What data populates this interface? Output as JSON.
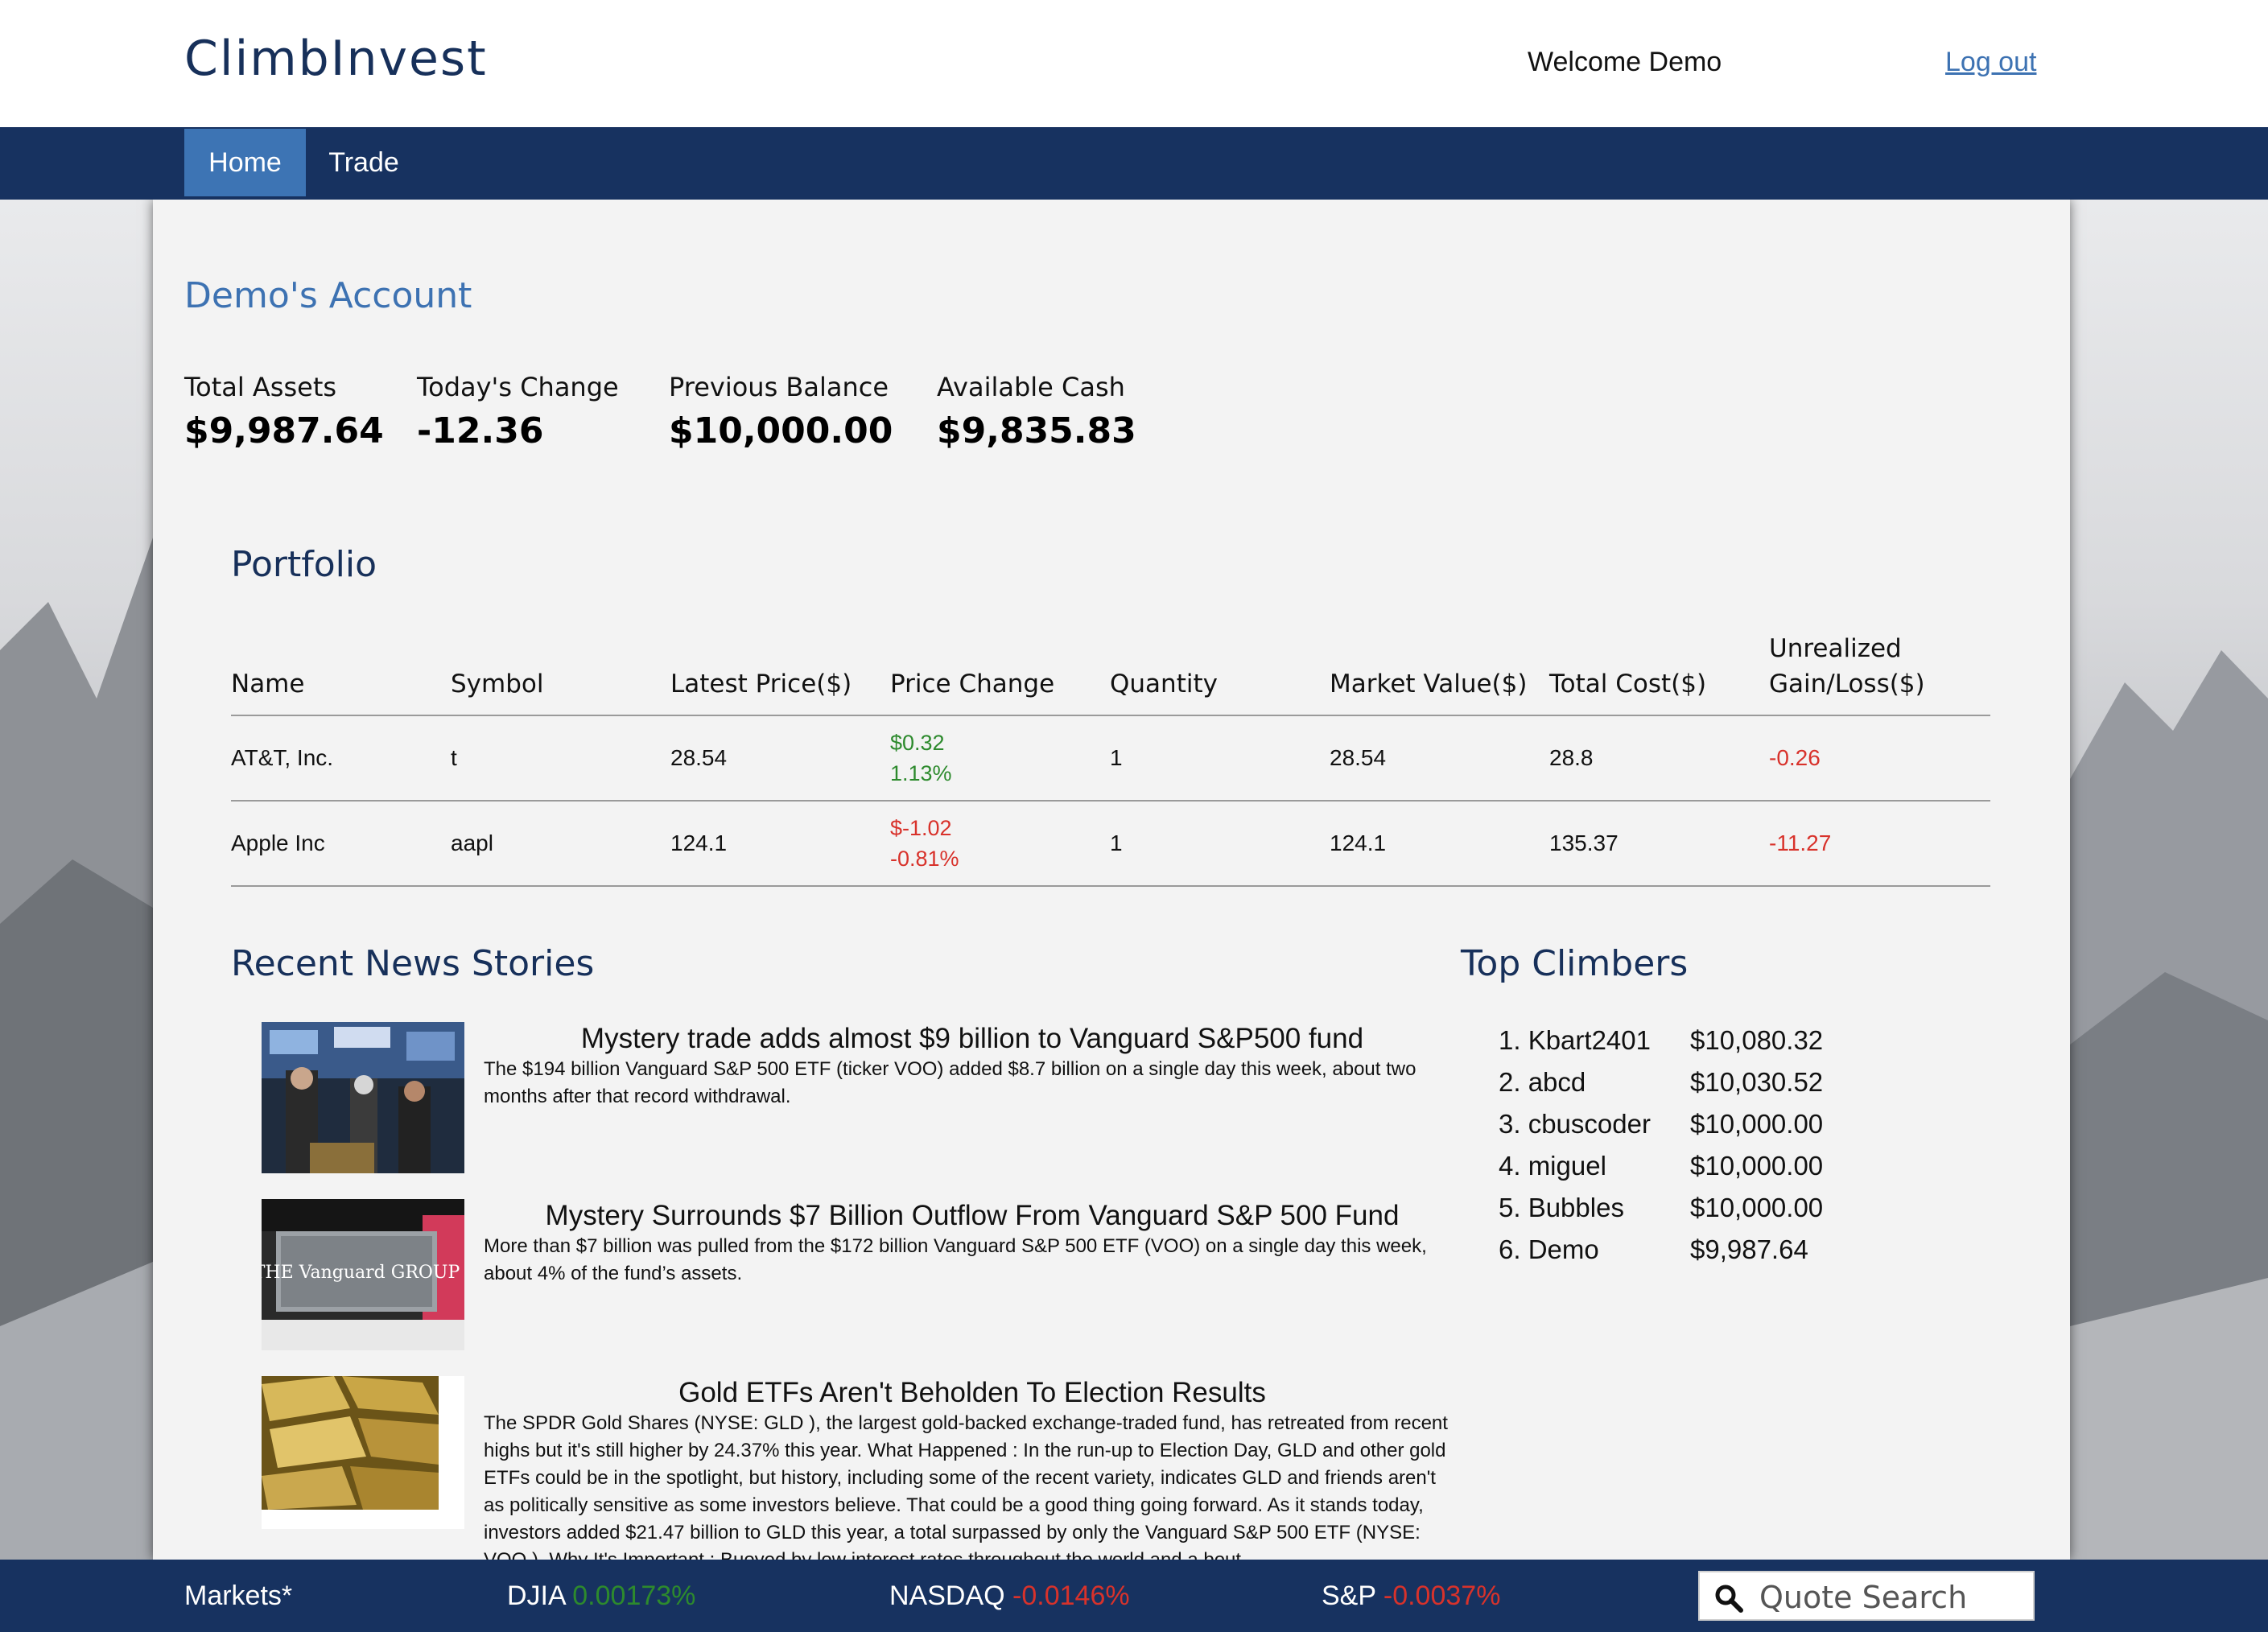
{
  "header": {
    "brand": "ClimbInvest",
    "welcome": "Welcome Demo",
    "logout": "Log out"
  },
  "nav": {
    "tabs": [
      {
        "label": "Home",
        "active": true
      },
      {
        "label": "Trade",
        "active": false
      }
    ]
  },
  "account": {
    "title": "Demo's Account",
    "stats": [
      {
        "label": "Total Assets",
        "value": "$9,987.64"
      },
      {
        "label": "Today's Change",
        "value": "-12.36"
      },
      {
        "label": "Previous Balance",
        "value": "$10,000.00"
      },
      {
        "label": "Available Cash",
        "value": "$9,835.83"
      }
    ]
  },
  "portfolio": {
    "title": "Portfolio",
    "columns": [
      "Name",
      "Symbol",
      "Latest Price($)",
      "Price Change",
      "Quantity",
      "Market Value($)",
      "Total Cost($)",
      "Unrealized",
      "Gain/Loss($)"
    ],
    "rows": [
      {
        "name": "AT&T, Inc.",
        "symbol": "t",
        "latest_price": "28.54",
        "change_amount": "$0.32",
        "change_percent": "1.13%",
        "quantity": "1",
        "market_value": "28.54",
        "total_cost": "28.8",
        "gain_loss": "-0.26"
      },
      {
        "name": "Apple Inc",
        "symbol": "aapl",
        "latest_price": "124.1",
        "change_amount": "$-1.02",
        "change_percent": "-0.81%",
        "quantity": "1",
        "market_value": "124.1",
        "total_cost": "135.37",
        "gain_loss": "-11.27"
      }
    ]
  },
  "news": {
    "title": "Recent News Stories",
    "items": [
      {
        "headline": "Mystery trade adds almost $9 billion to Vanguard S&P500 fund",
        "summary": "The $194 billion Vanguard S&P 500 ETF (ticker VOO) added $8.7 billion on a single day this week, about two months after that record withdrawal.",
        "image": "trading-floor-photo"
      },
      {
        "headline": "Mystery Surrounds $7 Billion Outflow From Vanguard S&P 500 Fund",
        "summary": "More than $7 billion was pulled from the $172 billion Vanguard S&P 500 ETF (VOO) on a single day this week, about 4% of the fund’s assets.",
        "image": "vanguard-sign-photo",
        "sign_text": "THE Vanguard GROUP"
      },
      {
        "headline": "Gold ETFs Aren't Beholden To Election Results",
        "summary": "The SPDR Gold Shares (NYSE: GLD ), the largest gold-backed exchange-traded fund, has retreated from recent highs but it's still higher by 24.37% this year. What Happened : In the run-up to Election Day, GLD and other gold ETFs could be in the spotlight, but history, including some of the recent variety, indicates GLD and friends aren't as politically sensitive as some investors believe. That could be a good thing going forward. As it stands today, investors added $21.47 billion to GLD this year, a total surpassed by only the Vanguard S&P 500 ETF (NYSE: VOO ). Why It's Important : Buoyed by low interest rates throughout the world and a bout",
        "image": "gold-bars-photo"
      }
    ]
  },
  "climbers": {
    "title": "Top Climbers",
    "items": [
      {
        "name": "1. Kbart2401",
        "value": "$10,080.32"
      },
      {
        "name": "2. abcd",
        "value": "$10,030.52"
      },
      {
        "name": "3. cbuscoder",
        "value": "$10,000.00"
      },
      {
        "name": "4. miguel",
        "value": "$10,000.00"
      },
      {
        "name": "5. Bubbles",
        "value": "$10,000.00"
      },
      {
        "name": "6. Demo",
        "value": "$9,987.64"
      }
    ]
  },
  "footer": {
    "markets_label": "Markets*",
    "indices": [
      {
        "name": "DJIA",
        "change": "0.00173%",
        "direction": "up"
      },
      {
        "name": "NASDAQ",
        "change": "-0.0146%",
        "direction": "down"
      },
      {
        "name": "S&P",
        "change": "-0.0037%",
        "direction": "down"
      }
    ],
    "quote_search_placeholder": "Quote Search"
  },
  "colors": {
    "navy": "#173260",
    "accent_blue": "#3d74b4",
    "positive": "#2d8a2d",
    "negative": "#d8322b"
  }
}
